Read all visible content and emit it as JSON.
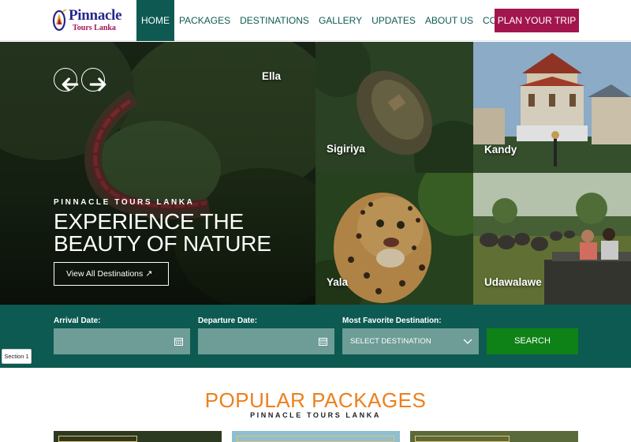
{
  "brand": {
    "name": "Pinnacle",
    "tagline": "Tours Lanka"
  },
  "nav": {
    "items": [
      {
        "label": "HOME",
        "active": true
      },
      {
        "label": "PACKAGES"
      },
      {
        "label": "DESTINATIONS"
      },
      {
        "label": "GALLERY"
      },
      {
        "label": "UPDATES"
      },
      {
        "label": "ABOUT US"
      },
      {
        "label": "CONTACT US"
      }
    ],
    "cta": "PLAN YOUR TRIP"
  },
  "hero": {
    "kicker": "PINNACLE TOURS LANKA",
    "title_line1": "EXPERIENCE THE",
    "title_line2": "BEAUTY OF NATURE",
    "button": "View All Destinations",
    "controls": {
      "prev_icon": "arrow-left-icon",
      "next_icon": "arrow-right-icon"
    },
    "destinations": [
      "Ella",
      "Sigiriya",
      "Kandy",
      "Yala",
      "Udawalawe"
    ]
  },
  "booking": {
    "arrival_label": "Arrival Date:",
    "departure_label": "Departure Date:",
    "destination_label": "Most Favorite Destination:",
    "destination_value": "SELECT DESTINATION",
    "search": "SEARCH"
  },
  "section_tag": "Section 1",
  "popular": {
    "title": "POPULAR PACKAGES",
    "subtitle": "PINNACLE TOURS LANKA"
  },
  "colors": {
    "primary": "#0e5a52",
    "accent": "#a3154d",
    "orange": "#ee7f1c",
    "search": "#0f8217"
  }
}
